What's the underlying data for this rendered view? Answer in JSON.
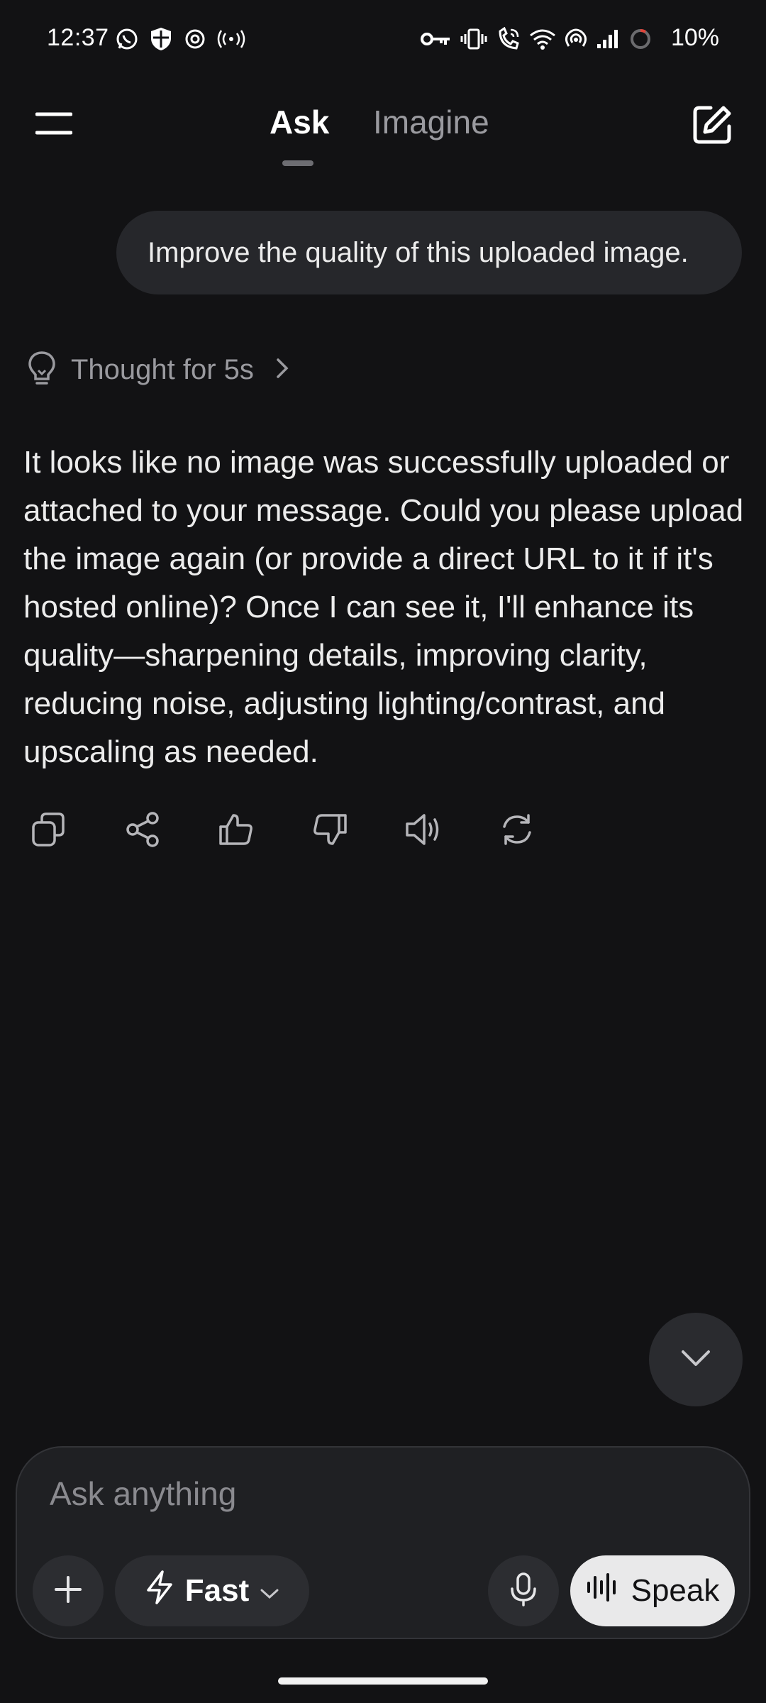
{
  "colors": {
    "background": "#121214",
    "bubble": "#26272b",
    "text": "#ececec",
    "muted": "#9a9a9f",
    "speak_button": "#e9e9ea"
  },
  "status_bar": {
    "time": "12:37",
    "left_icons": [
      "whatsapp-icon",
      "shield-icon",
      "openai-icon",
      "broadcast-icon"
    ],
    "right_icons": [
      "vpn-key-icon",
      "vibrate-icon",
      "wifi-calling-icon",
      "wifi-icon",
      "hotspot-icon",
      "signal-icon",
      "battery-ring-icon"
    ],
    "battery": "10%"
  },
  "header": {
    "tabs": [
      {
        "label": "Ask",
        "active": true
      },
      {
        "label": "Imagine",
        "active": false
      }
    ],
    "menu_icon": "menu-icon",
    "new_chat_icon": "edit-icon"
  },
  "conversation": {
    "user_message": "Improve the quality of this uploaded image.",
    "thought_label": "Thought for 5s",
    "answer": "It looks like no image was successfully uploaded or attached to your message. Could you please upload the image again (or provide a direct URL to it if it's hosted online)? Once I can see it, I'll enhance its quality—sharpening details, improving clarity, reducing noise, adjusting lighting/contrast, and upscaling as needed.",
    "actions": [
      "copy-icon",
      "share-icon",
      "thumbs-up-icon",
      "thumbs-down-icon",
      "speaker-icon",
      "regenerate-icon"
    ]
  },
  "composer": {
    "placeholder": "Ask anything",
    "value": "",
    "mode_label": "Fast",
    "speak_label": "Speak"
  }
}
